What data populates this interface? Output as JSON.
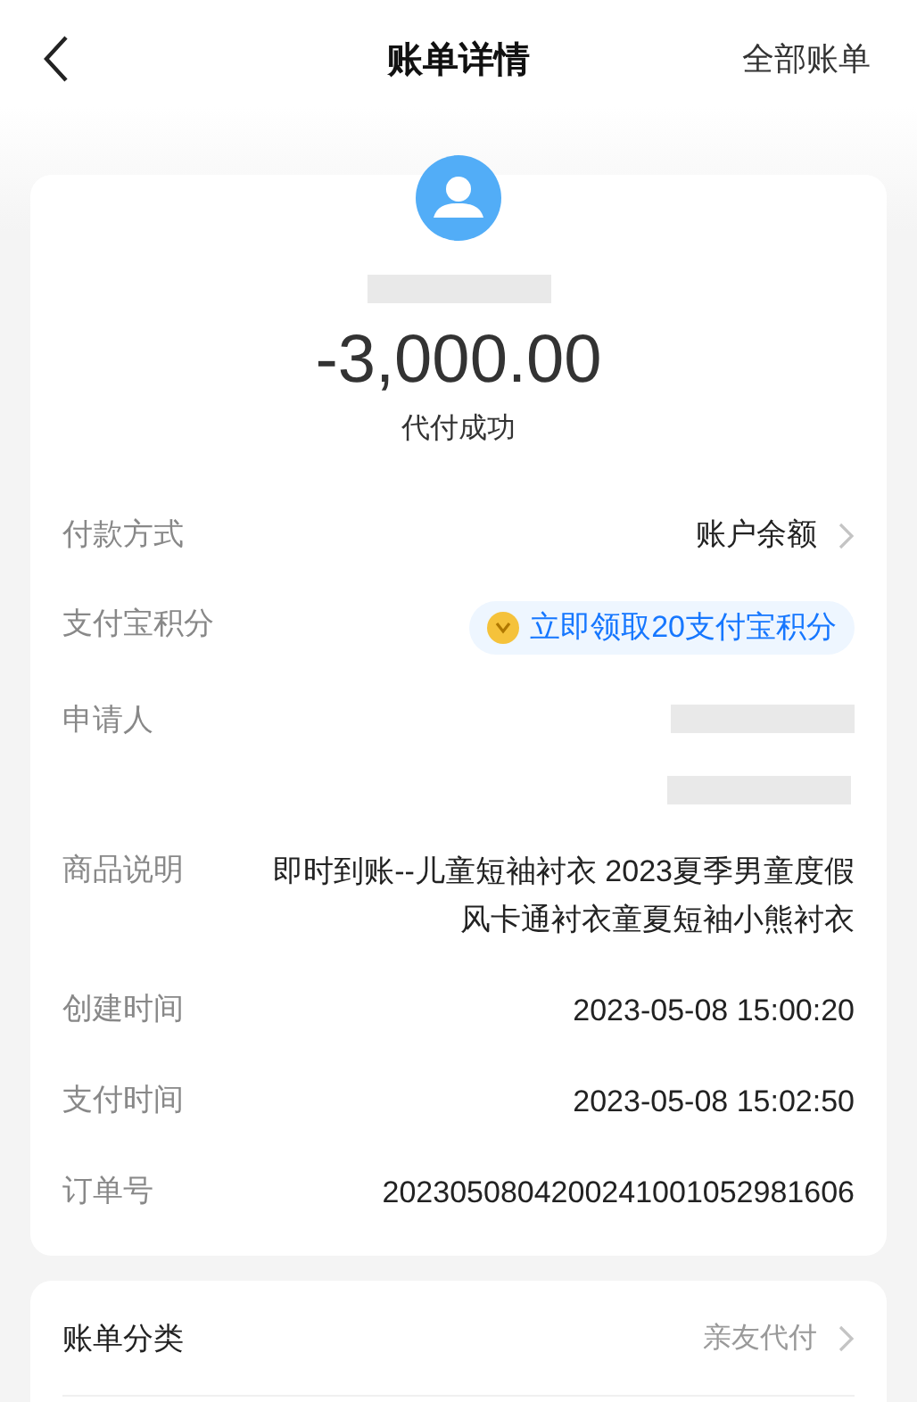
{
  "nav": {
    "title": "账单详情",
    "action": "全部账单"
  },
  "summary": {
    "amount": "-3,000.00",
    "status": "代付成功"
  },
  "details": [
    {
      "kind": "link",
      "label": "付款方式",
      "value": "账户余额"
    },
    {
      "kind": "badge",
      "label": "支付宝积分",
      "value": "立即领取20支付宝积分"
    },
    {
      "kind": "redacted",
      "label": "申请人"
    },
    {
      "kind": "text",
      "label": "商品说明",
      "value": "即时到账--儿童短袖衬衣 2023夏季男童度假风卡通衬衣童夏短袖小熊衬衣"
    },
    {
      "kind": "text",
      "label": "创建时间",
      "value": "2023-05-08 15:00:20"
    },
    {
      "kind": "text",
      "label": "支付时间",
      "value": "2023-05-08 15:02:50"
    },
    {
      "kind": "text",
      "label": "订单号",
      "value": "2023050804200241001052981606"
    }
  ],
  "category": {
    "label": "账单分类",
    "value": "亲友代付"
  }
}
